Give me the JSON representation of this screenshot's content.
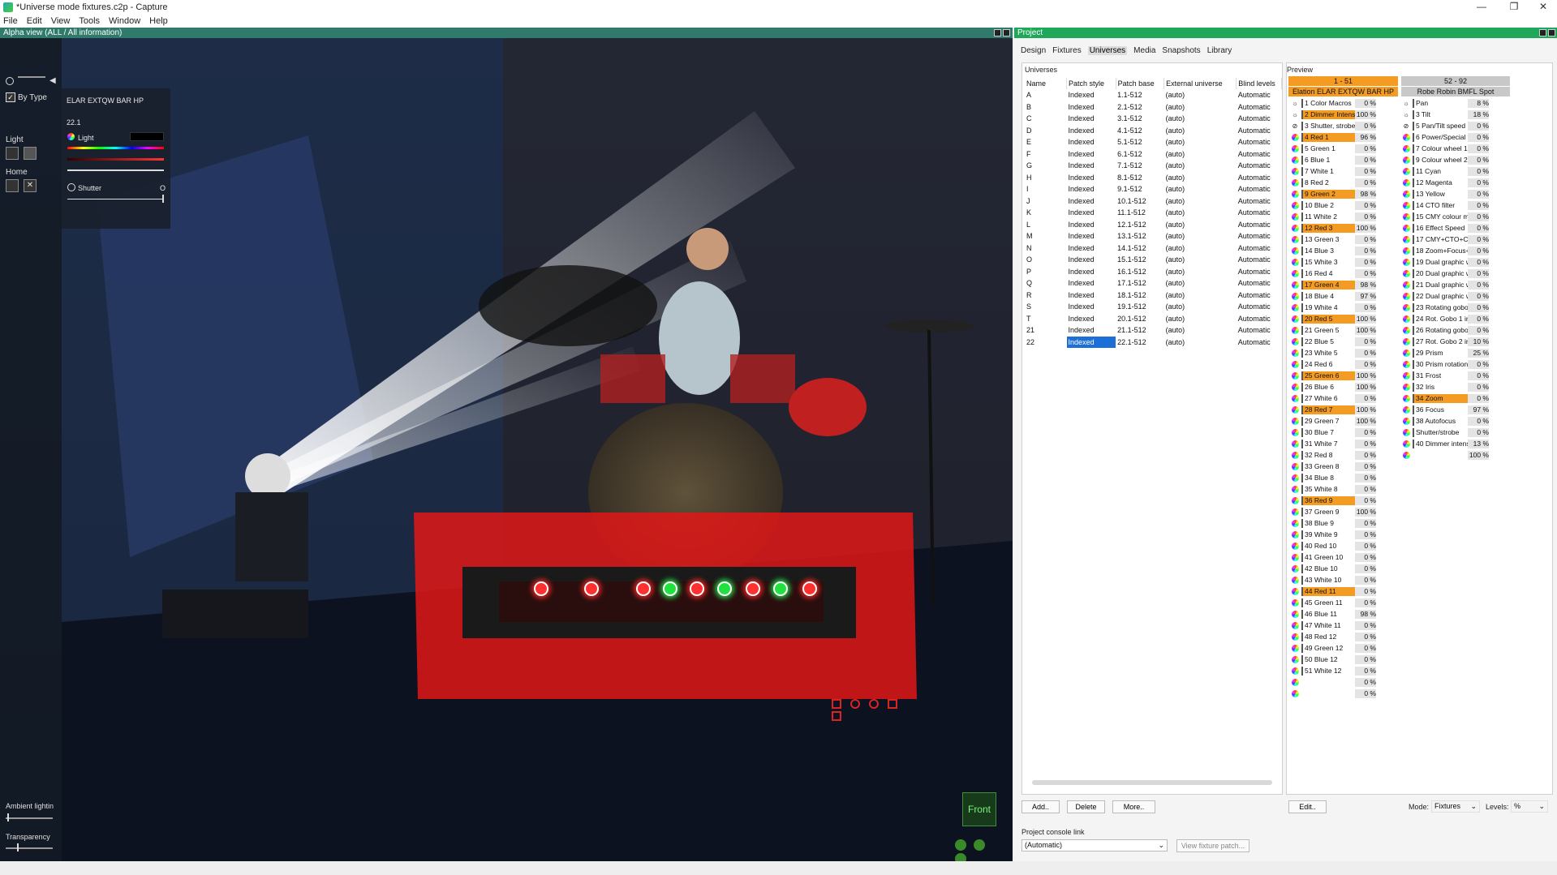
{
  "window": {
    "title": "*Universe mode fixtures.c2p - Capture"
  },
  "menu": [
    "File",
    "Edit",
    "View",
    "Tools",
    "Window",
    "Help"
  ],
  "view": {
    "header": "Alpha view  (ALL / All information)",
    "fixture_panel": {
      "name": "ELAR EXTQW BAR HP",
      "by_type": "By Type",
      "address": "22.1",
      "light_section": "Light",
      "light_label": "Light",
      "home_label": "Home",
      "shutter_label": "Shutter",
      "shutter_value": "O"
    },
    "ambient_label": "Ambient lightin",
    "transparency_label": "Transparency",
    "camera_label": "Front",
    "dots": [
      "red",
      "red",
      "red",
      "green",
      "red",
      "green",
      "red",
      "green",
      "red"
    ]
  },
  "project": {
    "header": "Project",
    "tabs": [
      "Design",
      "Fixtures",
      "Universes",
      "Media",
      "Snapshots",
      "Library"
    ],
    "active_tab": "Universes",
    "universes": {
      "label": "Universes",
      "columns": [
        "Name",
        "Patch style",
        "Patch base",
        "External universe",
        "Blind levels"
      ],
      "rows": [
        [
          "A",
          "Indexed",
          "1.1-512",
          "(auto)",
          "Automatic"
        ],
        [
          "B",
          "Indexed",
          "2.1-512",
          "(auto)",
          "Automatic"
        ],
        [
          "C",
          "Indexed",
          "3.1-512",
          "(auto)",
          "Automatic"
        ],
        [
          "D",
          "Indexed",
          "4.1-512",
          "(auto)",
          "Automatic"
        ],
        [
          "E",
          "Indexed",
          "5.1-512",
          "(auto)",
          "Automatic"
        ],
        [
          "F",
          "Indexed",
          "6.1-512",
          "(auto)",
          "Automatic"
        ],
        [
          "G",
          "Indexed",
          "7.1-512",
          "(auto)",
          "Automatic"
        ],
        [
          "H",
          "Indexed",
          "8.1-512",
          "(auto)",
          "Automatic"
        ],
        [
          "I",
          "Indexed",
          "9.1-512",
          "(auto)",
          "Automatic"
        ],
        [
          "J",
          "Indexed",
          "10.1-512",
          "(auto)",
          "Automatic"
        ],
        [
          "K",
          "Indexed",
          "11.1-512",
          "(auto)",
          "Automatic"
        ],
        [
          "L",
          "Indexed",
          "12.1-512",
          "(auto)",
          "Automatic"
        ],
        [
          "M",
          "Indexed",
          "13.1-512",
          "(auto)",
          "Automatic"
        ],
        [
          "N",
          "Indexed",
          "14.1-512",
          "(auto)",
          "Automatic"
        ],
        [
          "O",
          "Indexed",
          "15.1-512",
          "(auto)",
          "Automatic"
        ],
        [
          "P",
          "Indexed",
          "16.1-512",
          "(auto)",
          "Automatic"
        ],
        [
          "Q",
          "Indexed",
          "17.1-512",
          "(auto)",
          "Automatic"
        ],
        [
          "R",
          "Indexed",
          "18.1-512",
          "(auto)",
          "Automatic"
        ],
        [
          "S",
          "Indexed",
          "19.1-512",
          "(auto)",
          "Automatic"
        ],
        [
          "T",
          "Indexed",
          "20.1-512",
          "(auto)",
          "Automatic"
        ],
        [
          "21",
          "Indexed",
          "21.1-512",
          "(auto)",
          "Automatic"
        ],
        [
          "22",
          "Indexed",
          "22.1-512",
          "(auto)",
          "Automatic"
        ]
      ],
      "selected_row": 21,
      "add_label": "Add..",
      "delete_label": "Delete",
      "more_label": "More..",
      "console_link_label": "Project console link",
      "console_link_value": "(Automatic)",
      "view_patch_label": "View fixture patch..."
    },
    "preview": {
      "label": "Preview",
      "fixture1": {
        "range": "1 - 51",
        "name": "Elation ELAR EXTQW BAR HP"
      },
      "fixture2": {
        "range": "52 - 92",
        "name": "Robe Robin BMFL Spot"
      },
      "edit_label": "Edit..",
      "mode_label": "Mode:",
      "mode_value": "Fixtures",
      "levels_label": "Levels:",
      "levels_value": "%",
      "channels1": [
        {
          "n": "1 Color Macros",
          "v": 0
        },
        {
          "n": "2 Dimmer Intensity",
          "v": 100
        },
        {
          "n": "3 Shutter, strobe",
          "v": 0
        },
        {
          "n": "4 Red 1",
          "v": 96
        },
        {
          "n": "5 Green 1",
          "v": 0
        },
        {
          "n": "6 Blue 1",
          "v": 0
        },
        {
          "n": "7 White 1",
          "v": 0
        },
        {
          "n": "8 Red 2",
          "v": 0
        },
        {
          "n": "9 Green 2",
          "v": 98
        },
        {
          "n": "10 Blue 2",
          "v": 0
        },
        {
          "n": "11 White 2",
          "v": 0
        },
        {
          "n": "12 Red 3",
          "v": 100
        },
        {
          "n": "13 Green 3",
          "v": 0
        },
        {
          "n": "14 Blue 3",
          "v": 0
        },
        {
          "n": "15 White 3",
          "v": 0
        },
        {
          "n": "16 Red 4",
          "v": 0
        },
        {
          "n": "17 Green 4",
          "v": 98
        },
        {
          "n": "18 Blue 4",
          "v": 97
        },
        {
          "n": "19 White 4",
          "v": 0
        },
        {
          "n": "20 Red 5",
          "v": 100
        },
        {
          "n": "21 Green 5",
          "v": 100
        },
        {
          "n": "22 Blue 5",
          "v": 0
        },
        {
          "n": "23 White 5",
          "v": 0
        },
        {
          "n": "24 Red 6",
          "v": 0
        },
        {
          "n": "25 Green 6",
          "v": 100
        },
        {
          "n": "26 Blue 6",
          "v": 100
        },
        {
          "n": "27 White 6",
          "v": 0
        },
        {
          "n": "28 Red 7",
          "v": 100
        },
        {
          "n": "29 Green 7",
          "v": 100
        },
        {
          "n": "30 Blue 7",
          "v": 0
        },
        {
          "n": "31 White 7",
          "v": 0
        },
        {
          "n": "32 Red 8",
          "v": 0
        },
        {
          "n": "33 Green 8",
          "v": 0
        },
        {
          "n": "34 Blue 8",
          "v": 0
        },
        {
          "n": "35 White 8",
          "v": 0
        },
        {
          "n": "36 Red 9",
          "v": 0
        },
        {
          "n": "37 Green 9",
          "v": 100
        },
        {
          "n": "38 Blue 9",
          "v": 0
        },
        {
          "n": "39 White 9",
          "v": 0
        },
        {
          "n": "40 Red 10",
          "v": 0
        },
        {
          "n": "41 Green 10",
          "v": 0
        },
        {
          "n": "42 Blue 10",
          "v": 0
        },
        {
          "n": "43 White 10",
          "v": 0
        },
        {
          "n": "44 Red 11",
          "v": 0
        },
        {
          "n": "45 Green 11",
          "v": 0
        },
        {
          "n": "46 Blue 11",
          "v": 98
        },
        {
          "n": "47 White 11",
          "v": 0
        },
        {
          "n": "48 Red 12",
          "v": 0
        },
        {
          "n": "49 Green 12",
          "v": 0
        },
        {
          "n": "50 Blue 12",
          "v": 0
        },
        {
          "n": "51 White 12",
          "v": 0
        },
        {
          "n": "",
          "v": 0
        },
        {
          "n": "",
          "v": 0
        }
      ],
      "orange1": [
        1,
        3,
        8,
        11,
        16,
        19,
        24,
        27,
        35,
        43
      ],
      "channels2": [
        {
          "n": "Pan",
          "v": 8
        },
        {
          "n": "3 Tilt",
          "v": 18
        },
        {
          "n": "5 Pan/Tilt speed , P",
          "v": 0
        },
        {
          "n": "6 Power/Special fu",
          "v": 0
        },
        {
          "n": "7 Colour wheel 1",
          "v": 0
        },
        {
          "n": "9 Colour wheel 2",
          "v": 0
        },
        {
          "n": "11 Cyan",
          "v": 0
        },
        {
          "n": "12 Magenta",
          "v": 0
        },
        {
          "n": "13 Yellow",
          "v": 0
        },
        {
          "n": "14 CTO filter",
          "v": 0
        },
        {
          "n": "15 CMY colour mac",
          "v": 0
        },
        {
          "n": "16 Effect Speed",
          "v": 0
        },
        {
          "n": "17 CMY+CTO+Col",
          "v": 0
        },
        {
          "n": "18 Zoom+Focus+Ir",
          "v": 0
        },
        {
          "n": "19 Dual graphic wh",
          "v": 0
        },
        {
          "n": "20 Dual graphic wh",
          "v": 0
        },
        {
          "n": "21 Dual graphic wh",
          "v": 0
        },
        {
          "n": "22 Dual graphic wh",
          "v": 0
        },
        {
          "n": "23 Rotating gobo",
          "v": 0
        },
        {
          "n": "24 Rot. Gobo 1 ind",
          "v": 0
        },
        {
          "n": "26 Rotating gobo",
          "v": 0
        },
        {
          "n": "27 Rot. Gobo 2 ind",
          "v": 10
        },
        {
          "n": "29 Prism",
          "v": 25
        },
        {
          "n": "30 Prism rotation",
          "v": 0
        },
        {
          "n": "31 Frost",
          "v": 0
        },
        {
          "n": "32 Iris",
          "v": 0
        },
        {
          "n": "34 Zoom",
          "v": 0
        },
        {
          "n": "36 Focus",
          "v": 97
        },
        {
          "n": "38 Autofocus",
          "v": 0
        },
        {
          "n": "Shutter/strobe",
          "v": 0
        },
        {
          "n": "40 Dimmer intensit",
          "v": 13
        },
        {
          "n": "",
          "v": 100
        }
      ]
    }
  }
}
